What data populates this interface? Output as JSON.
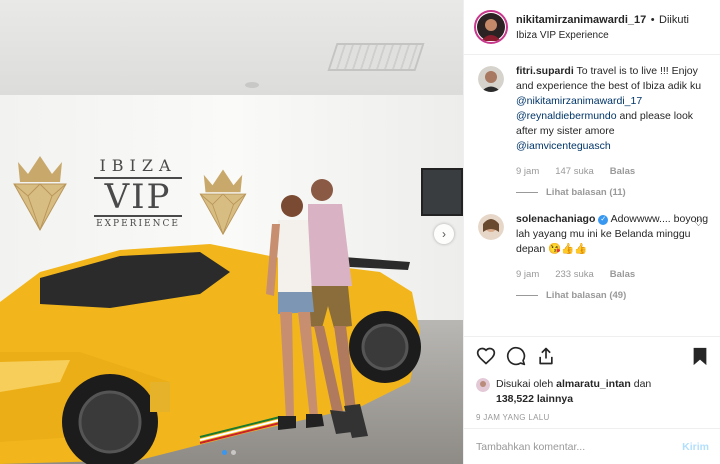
{
  "header": {
    "username": "nikitamirzanimawardi_17",
    "separator": "•",
    "follow_label": "Diikuti",
    "location": "Ibiza VIP Experience"
  },
  "photo": {
    "sign": {
      "top": "IBIZA",
      "mid": "VIP",
      "bottom": "EXPERIENCE"
    },
    "next_icon": "chevron-right-icon",
    "slide_count": 2,
    "active_slide": 1
  },
  "comments": [
    {
      "username": "fitri.supardi",
      "text_before": "To travel is to live !!! Enjoy and experience the best of Ibiza adik ku",
      "mention1": "@nikitamirzanimawardi_17",
      "mention2": "@reynaldiebermundo",
      "text_mid": "and please look after my sister amore",
      "mention3": "@iamvicenteguasch",
      "time": "9 jam",
      "likes": "147 suka",
      "reply": "Balas",
      "view_replies": "Lihat balasan (11)"
    },
    {
      "username": "solenachaniago",
      "verified": true,
      "text": "Adowwww.... boyong lah yayang mu ini ke Belanda minggu depan 😘👍👍",
      "time": "9 jam",
      "likes": "233 suka",
      "reply": "Balas",
      "view_replies": "Lihat balasan (49)"
    }
  ],
  "likes": {
    "prefix": "Disukai oleh",
    "user": "almaratu_intan",
    "connector": "dan",
    "count": "138,522 lainnya"
  },
  "timestamp": "9 JAM YANG LALU",
  "add_comment": {
    "placeholder": "Tambahkan komentar...",
    "post_label": "Kirim"
  },
  "colors": {
    "accent_blue": "#3897f0",
    "mention": "#003569",
    "car_yellow": "#f2b61c",
    "muted": "#999999"
  }
}
